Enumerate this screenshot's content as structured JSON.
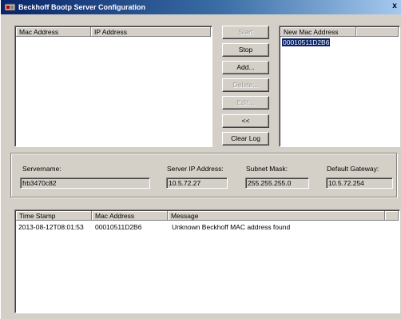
{
  "window": {
    "title": "Beckhoff Bootp Server Configuration",
    "close_glyph": "x"
  },
  "mac_list": {
    "headers": [
      "Mac Address",
      "IP Address"
    ]
  },
  "new_mac_list": {
    "header": "New Mac Address",
    "items": [
      "00010511D2B6"
    ]
  },
  "buttons": {
    "start": "Start",
    "stop": "Stop",
    "add": "Add...",
    "delete": "Delete...",
    "edit": "Edit...",
    "back": "<<",
    "clear_log": "Clear Log"
  },
  "server_info": {
    "servername_label": "Servername:",
    "servername_value": "frb3470c82",
    "server_ip_label": "Server IP Address:",
    "server_ip_value": "10.5.72.27",
    "subnet_label": "Subnet Mask:",
    "subnet_value": "255.255.255.0",
    "gateway_label": "Default Gateway:",
    "gateway_value": "10.5.72.254"
  },
  "log": {
    "headers": [
      "Time Stamp",
      "Mac Address",
      "Message"
    ],
    "rows": [
      {
        "time": "2013-08-12T08:01:53",
        "mac": "00010511D2B6",
        "message": "Unknown Beckhoff MAC address found"
      }
    ]
  },
  "colors": {
    "titlebar": "#0a246a",
    "face": "#d4d0c8",
    "selection": "#0a246a"
  }
}
